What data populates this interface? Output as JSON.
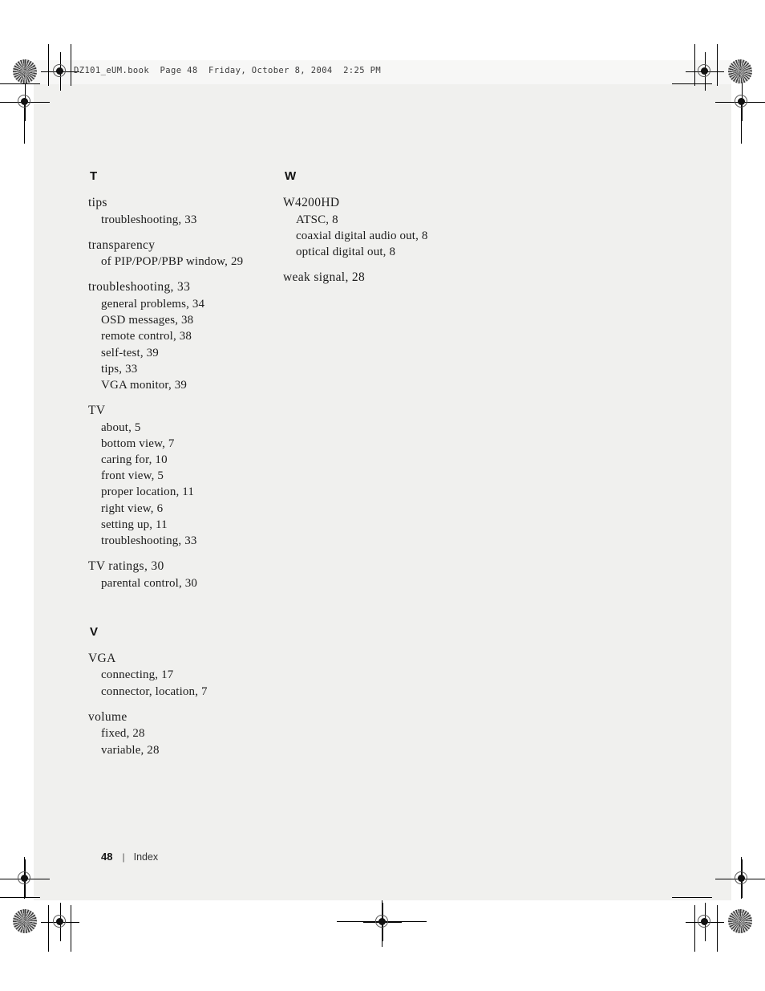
{
  "print_header": {
    "text": "DZ101_eUM.book  Page 48  Friday, October 8, 2004  2:25 PM"
  },
  "footer": {
    "page_number": "48",
    "separator": "|",
    "label": "Index"
  },
  "index": {
    "columns": [
      {
        "id": "left",
        "sections": [
          {
            "letter": "T",
            "groups": [
              {
                "main": "tips",
                "subs": [
                  "troubleshooting, 33"
                ]
              },
              {
                "main": "transparency",
                "subs": [
                  "of PIP/POP/PBP window, 29"
                ]
              },
              {
                "main": "troubleshooting, 33",
                "subs": [
                  "general problems, 34",
                  "OSD messages, 38",
                  "remote control, 38",
                  "self-test, 39",
                  "tips, 33",
                  "VGA monitor, 39"
                ]
              },
              {
                "main": "TV",
                "subs": [
                  "about, 5",
                  "bottom view, 7",
                  "caring for, 10",
                  "front view, 5",
                  "proper location, 11",
                  "right view, 6",
                  "setting up, 11",
                  "troubleshooting, 33"
                ]
              },
              {
                "main": "TV ratings, 30",
                "subs": [
                  "parental control, 30"
                ]
              }
            ]
          },
          {
            "letter": "V",
            "groups": [
              {
                "main": "VGA",
                "subs": [
                  "connecting, 17",
                  "connector, location, 7"
                ]
              },
              {
                "main": "volume",
                "subs": [
                  "fixed, 28",
                  "variable, 28"
                ]
              }
            ]
          }
        ]
      },
      {
        "id": "right",
        "sections": [
          {
            "letter": "W",
            "groups": [
              {
                "main": "W4200HD",
                "subs": [
                  "ATSC, 8",
                  "coaxial digital audio out, 8",
                  "optical digital out, 8"
                ]
              },
              {
                "main": "weak signal, 28",
                "subs": []
              }
            ]
          }
        ]
      }
    ]
  },
  "colors": {
    "page_background": "#f0f0ee",
    "sheet_white": "#ffffff",
    "text": "#1c1c1c",
    "crop_mark": "#000000"
  }
}
